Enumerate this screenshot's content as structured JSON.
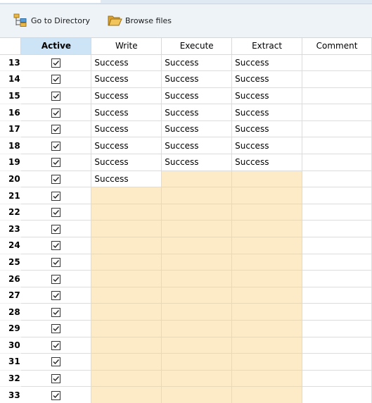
{
  "toolbar": {
    "go_to_directory_label": "Go to Directory",
    "browse_files_label": "Browse files"
  },
  "columns": {
    "row_number": "",
    "active": "Active",
    "write": "Write",
    "execute": "Execute",
    "extract": "Extract",
    "comment": "Comment"
  },
  "colors": {
    "active_header_bg": "#cde3f6",
    "pending_cell_bg": "#fdebc8",
    "toolbar_bg": "#eef3f8"
  },
  "rows": [
    {
      "num": "13",
      "active": true,
      "write": "Success",
      "execute": "Success",
      "extract": "Success",
      "comment": "",
      "pending": false
    },
    {
      "num": "14",
      "active": true,
      "write": "Success",
      "execute": "Success",
      "extract": "Success",
      "comment": "",
      "pending": false
    },
    {
      "num": "15",
      "active": true,
      "write": "Success",
      "execute": "Success",
      "extract": "Success",
      "comment": "",
      "pending": false
    },
    {
      "num": "16",
      "active": true,
      "write": "Success",
      "execute": "Success",
      "extract": "Success",
      "comment": "",
      "pending": false
    },
    {
      "num": "17",
      "active": true,
      "write": "Success",
      "execute": "Success",
      "extract": "Success",
      "comment": "",
      "pending": false
    },
    {
      "num": "18",
      "active": true,
      "write": "Success",
      "execute": "Success",
      "extract": "Success",
      "comment": "",
      "pending": false
    },
    {
      "num": "19",
      "active": true,
      "write": "Success",
      "execute": "Success",
      "extract": "Success",
      "comment": "",
      "pending": false
    },
    {
      "num": "20",
      "active": true,
      "write": "Success",
      "execute": "",
      "extract": "",
      "comment": "",
      "pending": "partial"
    },
    {
      "num": "21",
      "active": true,
      "write": "",
      "execute": "",
      "extract": "",
      "comment": "",
      "pending": true
    },
    {
      "num": "22",
      "active": true,
      "write": "",
      "execute": "",
      "extract": "",
      "comment": "",
      "pending": true
    },
    {
      "num": "23",
      "active": true,
      "write": "",
      "execute": "",
      "extract": "",
      "comment": "",
      "pending": true
    },
    {
      "num": "24",
      "active": true,
      "write": "",
      "execute": "",
      "extract": "",
      "comment": "",
      "pending": true
    },
    {
      "num": "25",
      "active": true,
      "write": "",
      "execute": "",
      "extract": "",
      "comment": "",
      "pending": true
    },
    {
      "num": "26",
      "active": true,
      "write": "",
      "execute": "",
      "extract": "",
      "comment": "",
      "pending": true
    },
    {
      "num": "27",
      "active": true,
      "write": "",
      "execute": "",
      "extract": "",
      "comment": "",
      "pending": true
    },
    {
      "num": "28",
      "active": true,
      "write": "",
      "execute": "",
      "extract": "",
      "comment": "",
      "pending": true
    },
    {
      "num": "29",
      "active": true,
      "write": "",
      "execute": "",
      "extract": "",
      "comment": "",
      "pending": true
    },
    {
      "num": "30",
      "active": true,
      "write": "",
      "execute": "",
      "extract": "",
      "comment": "",
      "pending": true
    },
    {
      "num": "31",
      "active": true,
      "write": "",
      "execute": "",
      "extract": "",
      "comment": "",
      "pending": true
    },
    {
      "num": "32",
      "active": true,
      "write": "",
      "execute": "",
      "extract": "",
      "comment": "",
      "pending": true
    },
    {
      "num": "33",
      "active": true,
      "write": "",
      "execute": "",
      "extract": "",
      "comment": "",
      "pending": true
    }
  ]
}
